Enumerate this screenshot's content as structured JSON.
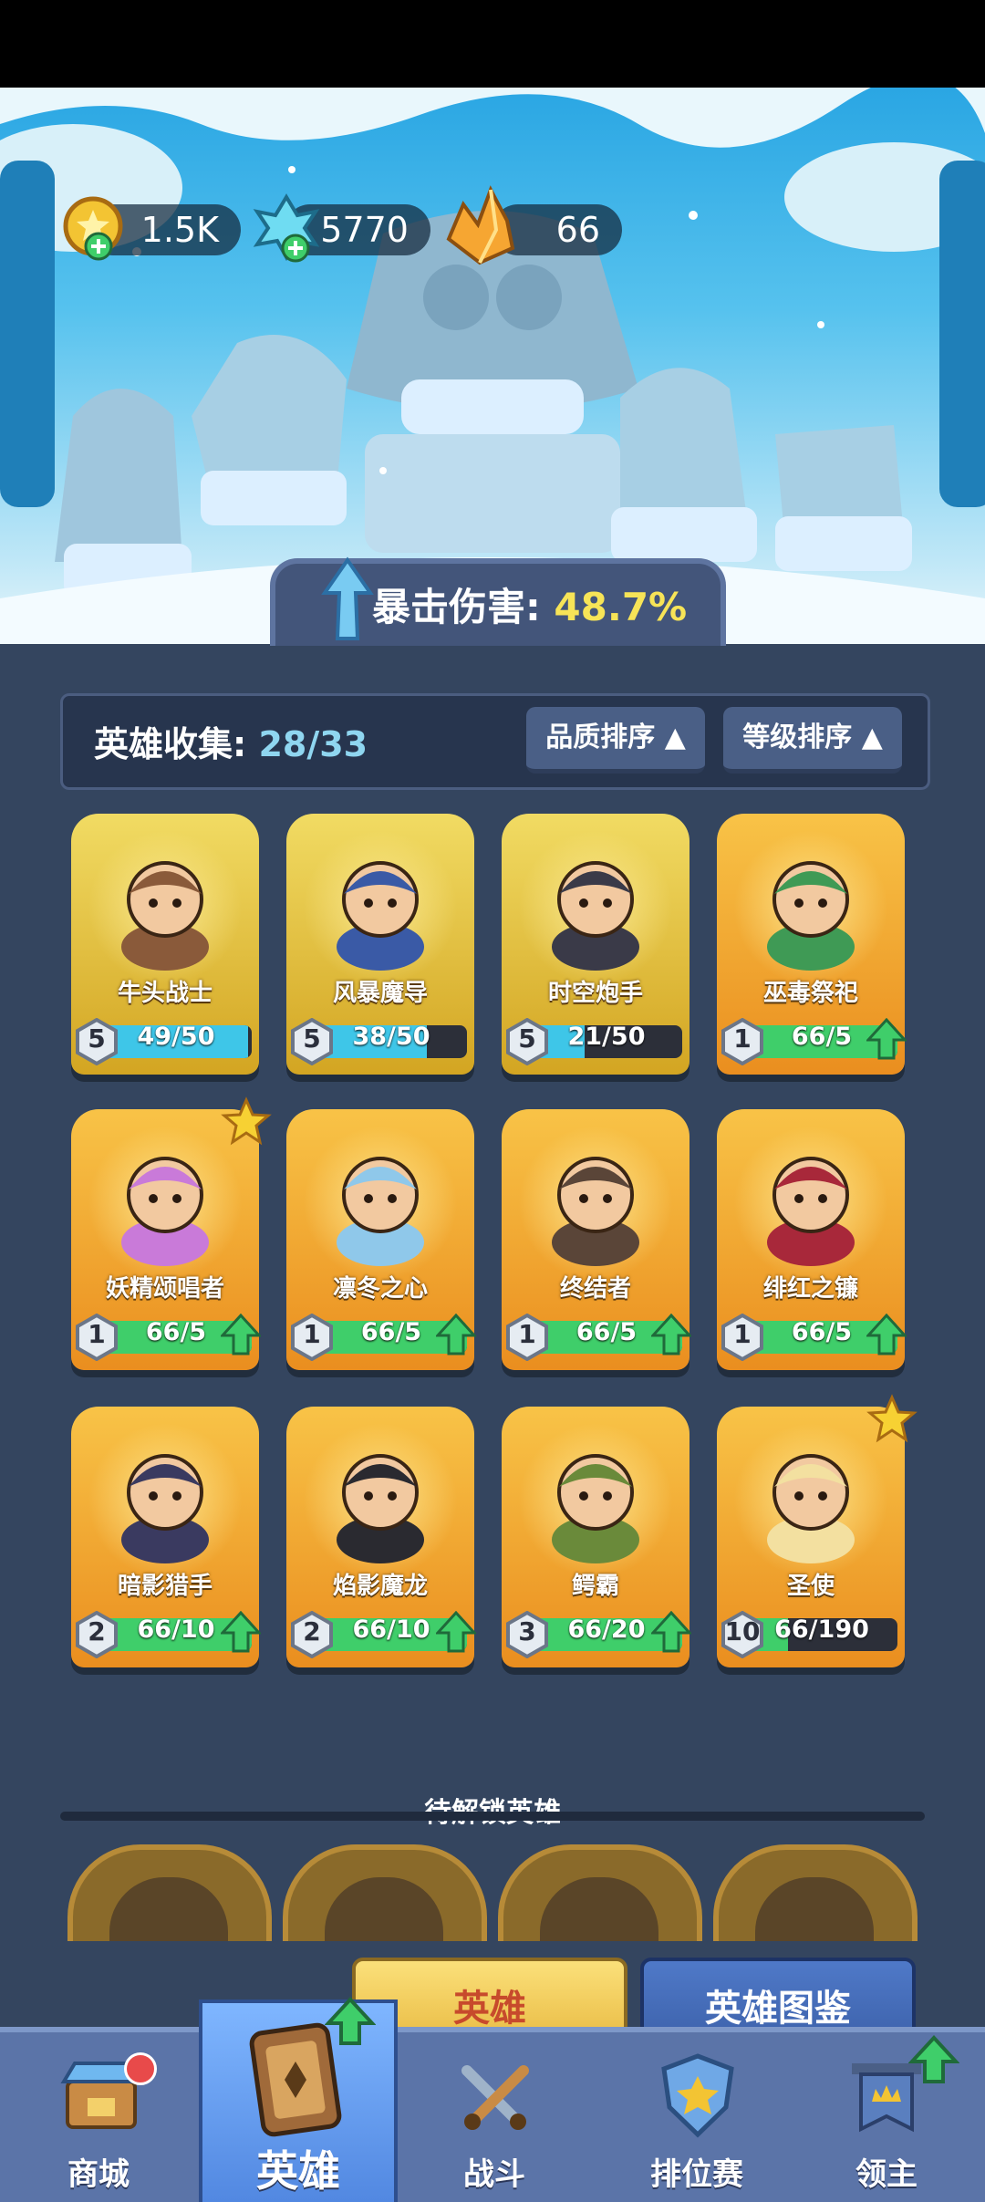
{
  "resources": [
    {
      "icon": "gold-coin-plus-icon",
      "value": "1.5K"
    },
    {
      "icon": "blue-crystal-plus-icon",
      "value": "5770"
    },
    {
      "icon": "orange-crystal-icon",
      "value": "66"
    }
  ],
  "buff": {
    "icon": "up-arrow-icon",
    "label": "暴击伤害:",
    "value": "48.7%"
  },
  "collection": {
    "label": "英雄收集:",
    "count": "28/33"
  },
  "sort": {
    "quality": "品质排序",
    "level": "等级排序"
  },
  "heroes": [
    {
      "name": "牛头战士",
      "level": "5",
      "count": "49/50",
      "progress": 0.98,
      "bar": "blue",
      "frame": "gold",
      "upgrade": false,
      "star": false,
      "art": "minotaur-portrait"
    },
    {
      "name": "风暴魔导",
      "level": "5",
      "count": "38/50",
      "progress": 0.76,
      "bar": "blue",
      "frame": "gold",
      "upgrade": false,
      "star": false,
      "art": "storm-wizard-portrait"
    },
    {
      "name": "时空炮手",
      "level": "5",
      "count": "21/50",
      "progress": 0.42,
      "bar": "blue",
      "frame": "gold",
      "upgrade": false,
      "star": false,
      "art": "gunner-portrait"
    },
    {
      "name": "巫毒祭祀",
      "level": "1",
      "count": "66/5",
      "progress": 1,
      "bar": "green",
      "frame": "orange",
      "upgrade": true,
      "star": false,
      "art": "voodoo-priestess-portrait"
    },
    {
      "name": "妖精颂唱者",
      "level": "1",
      "count": "66/5",
      "progress": 1,
      "bar": "green",
      "frame": "orange",
      "upgrade": true,
      "star": true,
      "art": "fairy-singer-portrait"
    },
    {
      "name": "凛冬之心",
      "level": "1",
      "count": "66/5",
      "progress": 1,
      "bar": "green",
      "frame": "orange",
      "upgrade": true,
      "star": false,
      "art": "ice-queen-portrait"
    },
    {
      "name": "终结者",
      "level": "1",
      "count": "66/5",
      "progress": 1,
      "bar": "green",
      "frame": "orange",
      "upgrade": true,
      "star": false,
      "art": "terminator-portrait"
    },
    {
      "name": "绯红之镰",
      "level": "1",
      "count": "66/5",
      "progress": 1,
      "bar": "green",
      "frame": "orange",
      "upgrade": true,
      "star": false,
      "art": "crimson-scythe-portrait"
    },
    {
      "name": "暗影猎手",
      "level": "2",
      "count": "66/10",
      "progress": 1,
      "bar": "green",
      "frame": "orange",
      "upgrade": true,
      "star": false,
      "art": "shadow-hunter-portrait"
    },
    {
      "name": "焰影魔龙",
      "level": "2",
      "count": "66/10",
      "progress": 1,
      "bar": "green",
      "frame": "orange",
      "upgrade": true,
      "star": false,
      "art": "dragon-portrait"
    },
    {
      "name": "鳄霸",
      "level": "3",
      "count": "66/20",
      "progress": 1,
      "bar": "green",
      "frame": "orange",
      "upgrade": true,
      "star": false,
      "art": "crocodile-portrait"
    },
    {
      "name": "圣使",
      "level": "10",
      "count": "66/190",
      "progress": 0.35,
      "bar": "green",
      "frame": "orange",
      "upgrade": false,
      "star": true,
      "art": "angel-portrait"
    }
  ],
  "locked_section": {
    "title": "待解锁英雄"
  },
  "buttons": {
    "heroes": "英雄",
    "codex": "英雄图鉴"
  },
  "nav": [
    {
      "label": "商城",
      "icon": "shop-icon",
      "active": false,
      "badge": "red-dot"
    },
    {
      "label": "英雄",
      "icon": "hero-card-icon",
      "active": true,
      "badge": "green-up-arrow"
    },
    {
      "label": "战斗",
      "icon": "crossed-swords-icon",
      "active": false,
      "badge": ""
    },
    {
      "label": "排位赛",
      "icon": "rank-shield-icon",
      "active": false,
      "badge": ""
    },
    {
      "label": "领主",
      "icon": "castle-banner-icon",
      "active": false,
      "badge": "green-up-arrow"
    }
  ],
  "colors": {
    "panel": "#34455f",
    "accent_yellow": "#f7e457",
    "count_blue": "#8fd6f0"
  }
}
